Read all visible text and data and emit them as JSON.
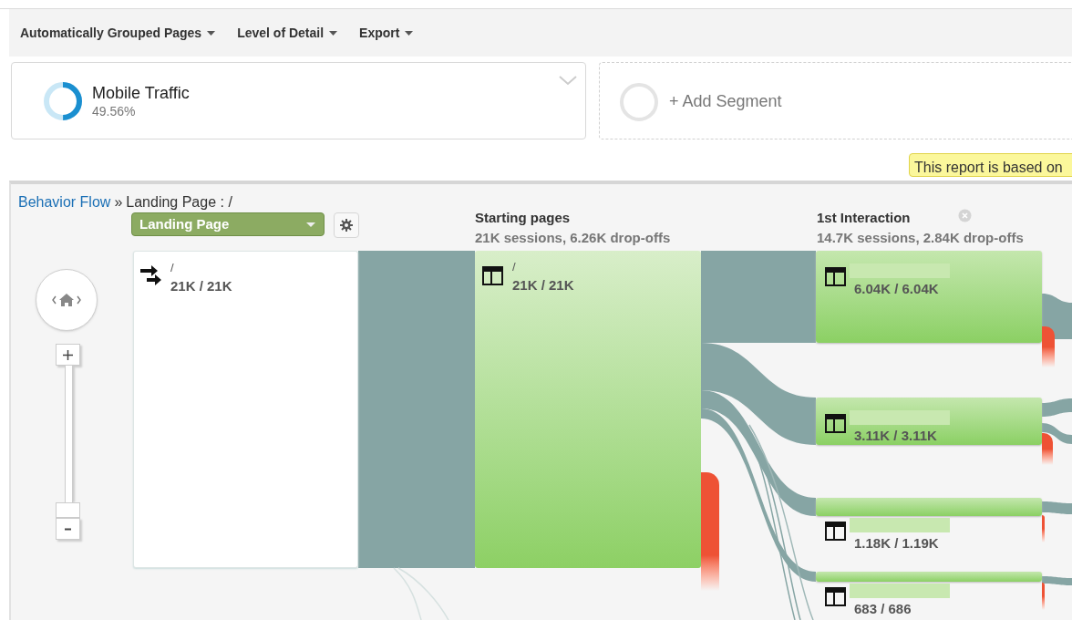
{
  "toolbar": {
    "menus": [
      "Automatically Grouped Pages",
      "Level of Detail",
      "Export"
    ]
  },
  "segments": [
    {
      "kind": "segment",
      "name": "Mobile Traffic",
      "share": "49.56%"
    },
    {
      "kind": "add",
      "label": "+ Add Segment"
    }
  ],
  "notice": "This report is based on",
  "breadcrumb": {
    "link": "Behavior Flow",
    "separator": "»",
    "current": "Landing Page : /"
  },
  "dimension_dropdown": "Landing Page",
  "columns": [
    {
      "title": "Starting pages",
      "summary": "21K sessions, 6.26K drop-offs",
      "closable": false
    },
    {
      "title": "1st Interaction",
      "summary": "14.7K sessions, 2.84K drop-offs",
      "closable": true
    }
  ],
  "landing_node": {
    "name": "/",
    "counts": "21K / 21K"
  },
  "starting_node": {
    "name": "/",
    "counts": "21K / 21K"
  },
  "interaction_nodes": [
    {
      "counts": "6.04K / 6.04K"
    },
    {
      "counts": "3.11K / 3.11K"
    },
    {
      "counts": "1.18K / 1.19K"
    },
    {
      "counts": "683 / 686"
    }
  ]
}
